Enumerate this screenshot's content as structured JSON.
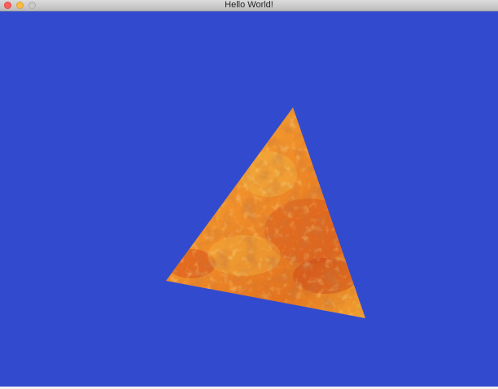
{
  "window": {
    "title": "Hello World!",
    "controls": {
      "close": "close-button",
      "minimize": "minimize-button",
      "zoom": "zoom-button"
    }
  },
  "scene": {
    "background_color": "#324bce",
    "shape": "triangle",
    "texture": "orange-rock",
    "texture_colors": [
      "#f5a327",
      "#e8741f",
      "#c94a1a",
      "#f7c94a",
      "#8b3a12"
    ]
  }
}
